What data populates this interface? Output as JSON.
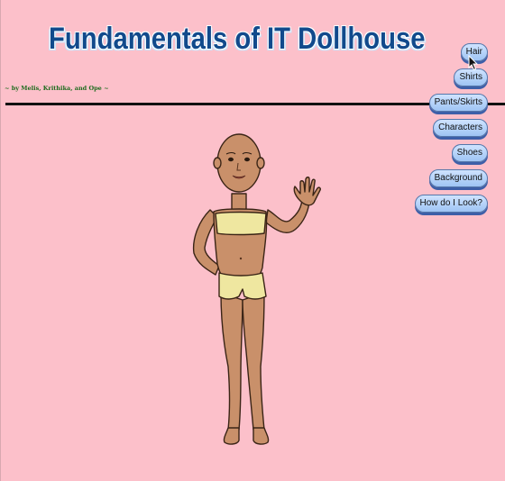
{
  "title": "Fundamentals of IT Dollhouse",
  "credit": "~ by Melis, Krithika, and Ope ~",
  "nav": [
    {
      "label": "Hair",
      "name": "nav-hair-button"
    },
    {
      "label": "Shirts",
      "name": "nav-shirts-button"
    },
    {
      "label": "Pants/Skirts",
      "name": "nav-pants-skirts-button"
    },
    {
      "label": "Characters",
      "name": "nav-characters-button"
    },
    {
      "label": "Shoes",
      "name": "nav-shoes-button"
    },
    {
      "label": "Background",
      "name": "nav-background-button"
    },
    {
      "label": "How do I Look?",
      "name": "nav-how-do-i-look-button"
    }
  ],
  "colors": {
    "background": "#fcc0ca",
    "title": "#114a8c",
    "button": "#9ec4f4",
    "credit": "#1d6b1d",
    "skin": "#c9906a",
    "clothing": "#efe7a0"
  },
  "icons": {
    "cursor": "mouse-pointer-icon"
  }
}
